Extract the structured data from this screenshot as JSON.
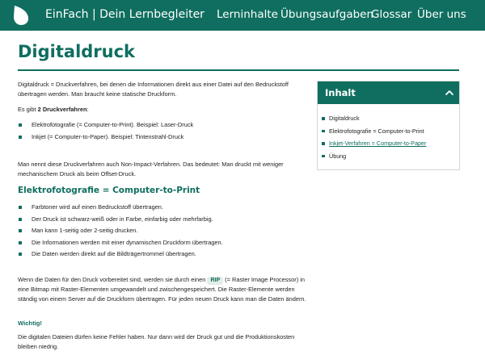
{
  "header": {
    "logo_icon": "leaf-drop-icon",
    "brand": "EinFach | Dein Lernbegleiter",
    "nav": [
      "Lerninhalte",
      "Übungsaufgaben",
      "Glossar",
      "Über uns"
    ]
  },
  "page": {
    "title": "Digitaldruck",
    "intro": "Digitaldruck = Druckverfahren, bei denen die Informationen direkt aus einer Datei auf den Bedruckstoff übertragen werden. Man braucht keine statische Druckform.",
    "gives_prefix": "Es gibt ",
    "gives_bold": "2 Druckverfahren",
    "gives_suffix": ":",
    "methods": [
      "Elektrofotografie (= Computer-to-Print). Beispiel: Laser-Druck",
      "Inkjet (= Computer-to-Paper). Beispiel: Tintenstrahl-Druck"
    ],
    "non_impact": "Man nennt diese Druckverfahren auch Non-Impact-Verfahren. Das bedeutet: Man druckt mit weniger mechanischem Druck als beim Offset-Druck.",
    "section_heading": "Elektrofotografie = Computer-to-Print",
    "section_items": [
      "Farbtoner wird auf einen Bedruckstoff übertragen.",
      "Der Druck ist schwarz-weiß oder in Farbe, einfarbig oder mehrfarbig.",
      "Man kann 1-seitig oder 2-seitig drucken.",
      "Die Informationen werden mit einer dynamischen Druckform übertragen.",
      "Die Daten werden direkt auf die Bildträgertrommel übertragen."
    ],
    "rip_before": "Wenn die Daten für den Druck vorbereitet sind, werden sie durch einen ",
    "rip_tag": "RIP",
    "rip_after": " (= Raster Image Processor) in eine Bitmap mit Raster-Elementen umgewandelt und zwischengespeichert. Die Raster-Elemente werden ständig von einem Server auf die Druckform übertragen. Für jeden neuen Druck kann man die Daten ändern.",
    "important_heading": "Wichtig!",
    "important_text": "Die digitalen Dateien dürfen keine Fehler haben. Nur dann wird der Druck gut und die Produktionskosten bleiben niedrig."
  },
  "toc": {
    "title": "Inhalt",
    "toggle_icon": "chevron-up-icon",
    "items": [
      "Digitaldruck",
      "Elektrofotografie = Computer-to-Print",
      "Inkjet-Verfahren = Computer-to-Paper",
      "Übung"
    ],
    "active_index": 2
  },
  "colors": {
    "brand": "#0f6e5f",
    "rip_bg": "#e3ece6"
  }
}
